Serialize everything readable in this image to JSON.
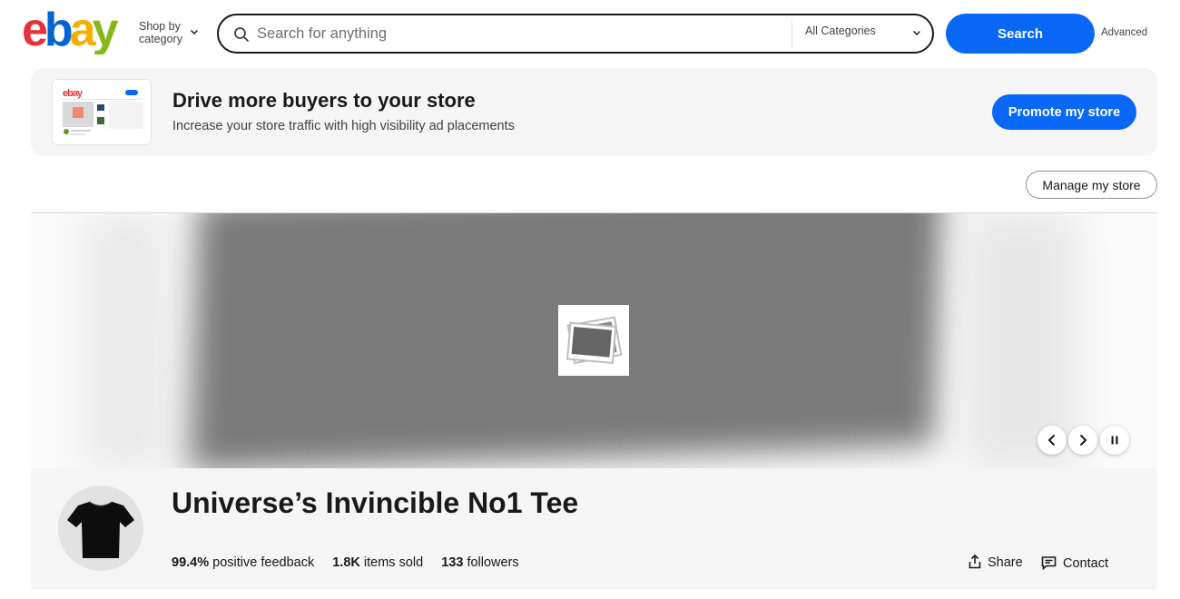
{
  "header": {
    "logo": "ebay",
    "shop_by_category": "Shop by category",
    "search_placeholder": "Search for anything",
    "category_selected": "All Categories",
    "search_button": "Search",
    "advanced_link": "Advanced"
  },
  "promo": {
    "thumb_logo": "ebay",
    "title": "Drive more buyers to your store",
    "subtitle": "Increase your store traffic with high visibility ad placements",
    "button": "Promote my store"
  },
  "manage_store_button": "Manage my store",
  "hero": {
    "placeholder_icon": "image-placeholder-icon",
    "controls": [
      "chevron-left-icon",
      "chevron-right-icon",
      "pause-icon"
    ]
  },
  "store": {
    "name": "Universe’s Invincible No1 Tee",
    "feedback_value": "99.4%",
    "feedback_label": "positive feedback",
    "sold_value": "1.8K",
    "sold_label": "items sold",
    "followers_value": "133",
    "followers_label": "followers",
    "share_label": "Share",
    "contact_label": "Contact"
  },
  "colors": {
    "primary_blue": "#0968f6",
    "logo_red": "#e53238",
    "logo_blue": "#0064d2",
    "logo_yellow": "#f5af02",
    "logo_green": "#86b817"
  }
}
